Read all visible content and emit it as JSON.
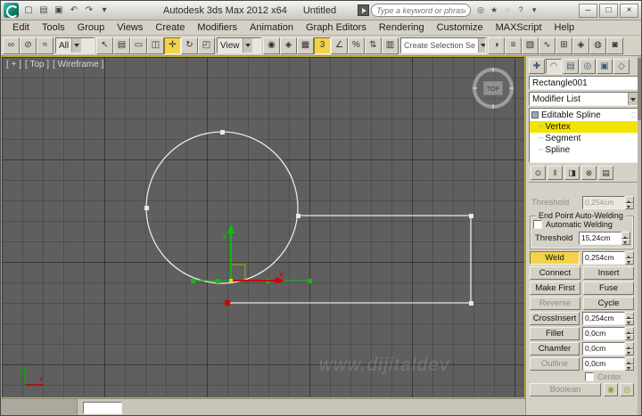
{
  "titlebar": {
    "app_title": "Autodesk 3ds Max  2012 x64",
    "doc_title": "Untitled",
    "search_placeholder": "Type a keyword or phrase",
    "qat": [
      {
        "name": "new-scene-icon",
        "glyph": "▢"
      },
      {
        "name": "open-file-icon",
        "glyph": "▤"
      },
      {
        "name": "save-file-icon",
        "glyph": "▣"
      },
      {
        "name": "undo-icon",
        "glyph": "↶"
      },
      {
        "name": "redo-icon",
        "glyph": "↷"
      },
      {
        "name": "quick-access-caret-icon",
        "glyph": "▾"
      }
    ],
    "help_icons": [
      {
        "name": "communication-center-icon",
        "glyph": "◎"
      },
      {
        "name": "favorites-icon",
        "glyph": "★"
      },
      {
        "name": "search-icon",
        "glyph": "◌"
      },
      {
        "name": "help-icon",
        "glyph": "?"
      },
      {
        "name": "help-caret-icon",
        "glyph": "▾"
      }
    ],
    "window_buttons": [
      {
        "name": "minimize-button",
        "glyph": "–"
      },
      {
        "name": "maximize-button",
        "glyph": "□"
      },
      {
        "name": "close-button",
        "glyph": "×"
      }
    ]
  },
  "menubar": {
    "items": [
      "Edit",
      "Tools",
      "Group",
      "Views",
      "Create",
      "Modifiers",
      "Animation",
      "Graph Editors",
      "Rendering",
      "Customize",
      "MAXScript",
      "Help"
    ]
  },
  "toolbar": {
    "filter_value": "All",
    "coord_value": "View",
    "selection_set_value": "Create Selection Se",
    "icons_left": [
      {
        "name": "select-and-link-icon",
        "glyph": "∞"
      },
      {
        "name": "unlink-selection-icon",
        "glyph": "⊘"
      },
      {
        "name": "bind-to-space-warp-icon",
        "glyph": "≈"
      }
    ],
    "icons_select": [
      {
        "name": "select-object-icon",
        "glyph": "↖"
      },
      {
        "name": "select-by-name-icon",
        "glyph": "▤"
      },
      {
        "name": "rectangular-selection-region-icon",
        "glyph": "▭"
      },
      {
        "name": "window-crossing-icon",
        "glyph": "◫"
      },
      {
        "name": "select-and-move-icon",
        "glyph": "✛",
        "active": true
      },
      {
        "name": "select-and-rotate-icon",
        "glyph": "↻"
      },
      {
        "name": "select-and-scale-icon",
        "glyph": "◰"
      }
    ],
    "icons_center": [
      {
        "name": "use-pivot-center-icon",
        "glyph": "◉"
      },
      {
        "name": "select-and-manipulate-icon",
        "glyph": "◈"
      },
      {
        "name": "keyboard-shortcut-override-icon",
        "glyph": "▦"
      },
      {
        "name": "snaps-toggle-icon",
        "glyph": "3",
        "active": true
      },
      {
        "name": "angle-snap-icon",
        "glyph": "∠"
      },
      {
        "name": "percent-snap-icon",
        "glyph": "%"
      },
      {
        "name": "spinner-snap-icon",
        "glyph": "⇅"
      },
      {
        "name": "edit-named-selection-sets-icon",
        "glyph": "▥"
      }
    ],
    "icons_right": [
      {
        "name": "mirror-icon",
        "glyph": "◑"
      },
      {
        "name": "align-icon",
        "glyph": "≡"
      },
      {
        "name": "layer-manager-icon",
        "glyph": "▧"
      },
      {
        "name": "curve-editor-icon",
        "glyph": "∿"
      },
      {
        "name": "schematic-view-icon",
        "glyph": "⊞"
      },
      {
        "name": "material-editor-icon",
        "glyph": "◈"
      },
      {
        "name": "render-setup-icon",
        "glyph": "◍"
      },
      {
        "name": "render-production-icon",
        "glyph": "◙"
      }
    ]
  },
  "viewport": {
    "label_plus": "[ + ]",
    "label_view": "[ Top ]",
    "label_shading": "[ Wireframe ]",
    "viewcube_label": "TOP",
    "axis_x_label": "x",
    "axis_y_label": "y",
    "tripod_x_label": "x",
    "tripod_y_label": "y",
    "watermark": "www.dijitaldev"
  },
  "command_panel": {
    "tabs": [
      {
        "name": "tab-create",
        "glyph": "✚"
      },
      {
        "name": "tab-modify",
        "glyph": "◠"
      },
      {
        "name": "tab-hierarchy",
        "glyph": "▤"
      },
      {
        "name": "tab-motion",
        "glyph": "◎"
      },
      {
        "name": "tab-display",
        "glyph": "▣"
      },
      {
        "name": "tab-utilities",
        "glyph": "◇"
      }
    ],
    "object_name": "Rectangle001",
    "modifier_list_label": "Modifier List",
    "stack": {
      "root_label": "Editable Spline",
      "items": [
        "Vertex",
        "Segment",
        "Spline"
      ],
      "selected_item": "Vertex"
    },
    "stack_tools": [
      {
        "name": "pin-stack-icon",
        "glyph": "⊙"
      },
      {
        "name": "show-end-result-icon",
        "glyph": "‖"
      },
      {
        "name": "make-unique-icon",
        "glyph": "◨"
      },
      {
        "name": "remove-modifier-icon",
        "glyph": "⊗"
      },
      {
        "name": "configure-modifier-sets-icon",
        "glyph": "▤"
      }
    ],
    "rollout": {
      "threshold_top_label": "Threshold",
      "threshold_top_value": "0,254cm",
      "group_title": "End Point Auto-Welding",
      "auto_weld_label": "Automatic Welding",
      "threshold_label": "Threshold",
      "threshold_value": "15,24cm",
      "weld_label": "Weld",
      "weld_value": "0,254cm",
      "connect_label": "Connect",
      "insert_label": "Insert",
      "make_first_label": "Make First",
      "fuse_label": "Fuse",
      "reverse_label": "Reverse",
      "cycle_label": "Cycle",
      "crossinsert_label": "CrossInsert",
      "crossinsert_value": "0,254cm",
      "fillet_label": "Fillet",
      "fillet_value": "0,0cm",
      "chamfer_label": "Chamfer",
      "chamfer_value": "0,0cm",
      "outline_label": "Outline",
      "outline_value": "0,0cm",
      "center_label": "Center",
      "boolean_label": "Boolean",
      "boolean_icons": [
        {
          "name": "boolean-union-icon",
          "glyph": "◉"
        },
        {
          "name": "boolean-subtract-icon",
          "glyph": "◎"
        }
      ]
    }
  }
}
